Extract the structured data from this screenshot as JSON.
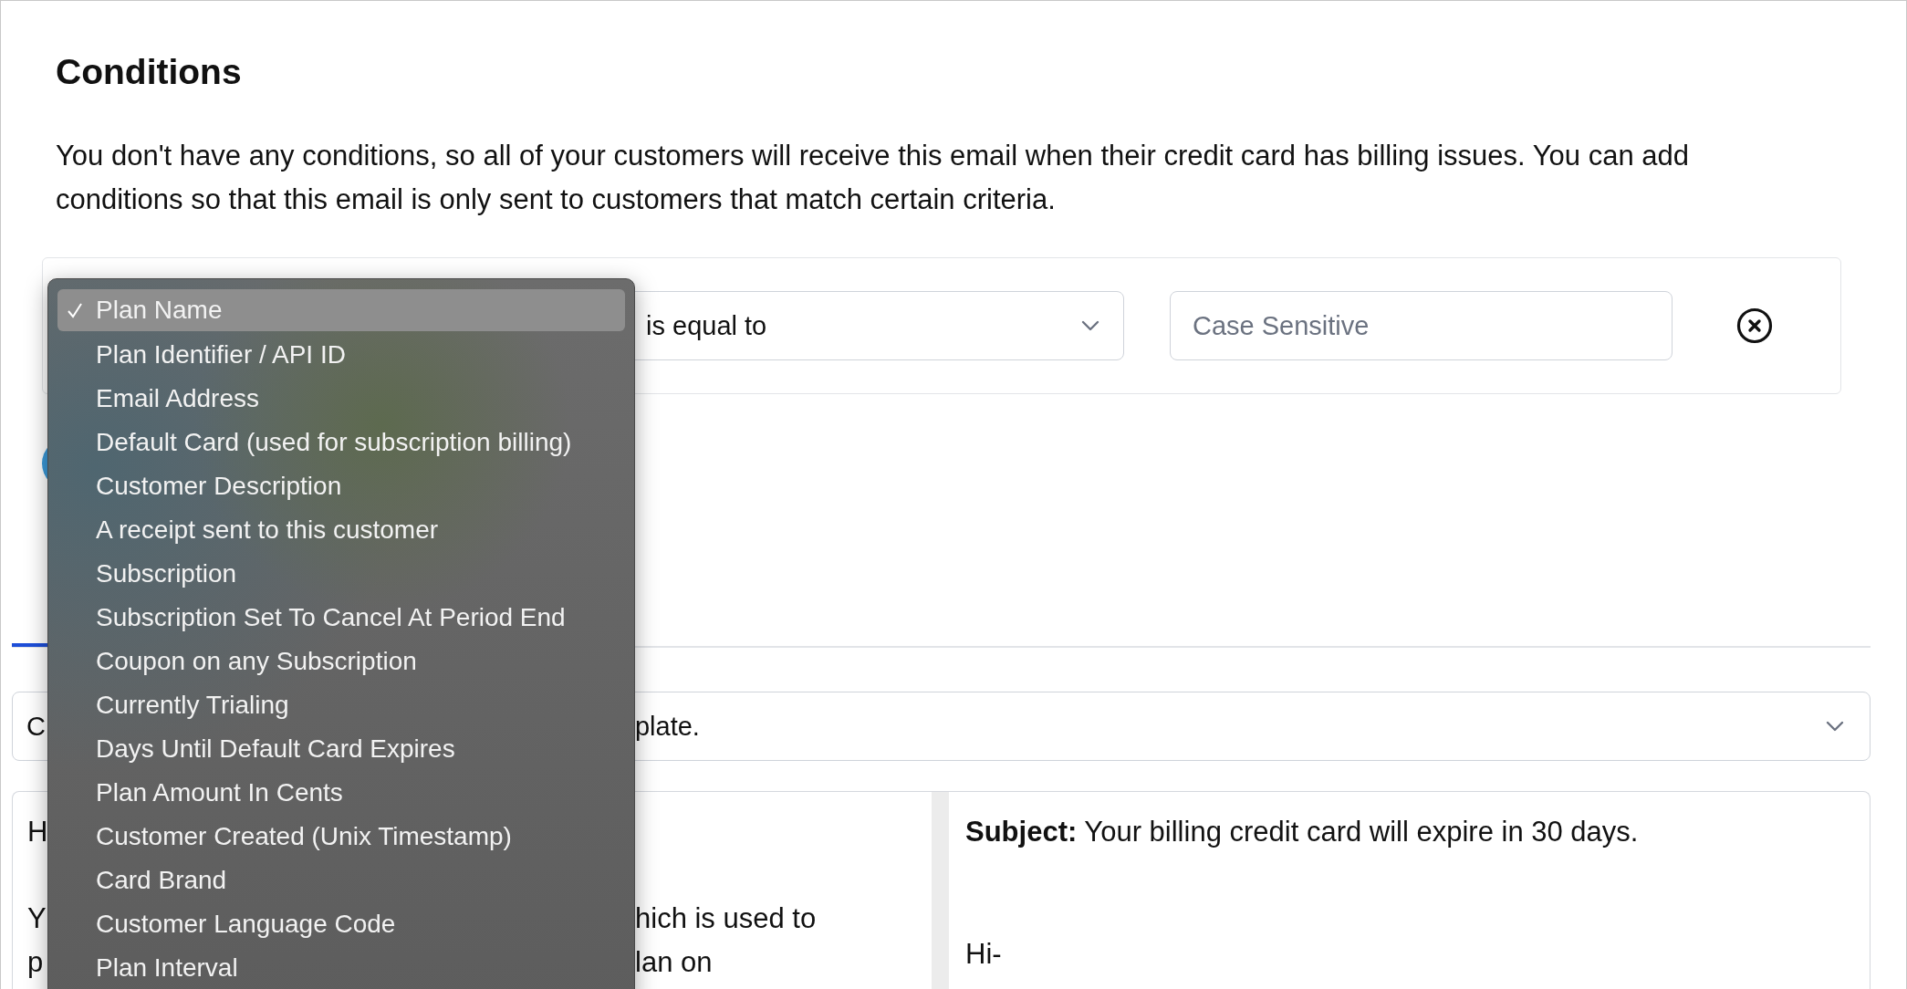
{
  "heading": "Conditions",
  "description": "You don't have any conditions, so all of your customers will receive this email when their credit card has billing issues. You can add conditions so that this email is only sent to customers that match certain criteria.",
  "condition": {
    "operator": "is equal to",
    "placeholder": "Case Sensitive"
  },
  "field_menu": {
    "items": [
      {
        "label": "Plan Name",
        "selected": true
      },
      {
        "label": "Plan Identifier / API ID",
        "selected": false
      },
      {
        "label": "Email Address",
        "selected": false
      },
      {
        "label": "Default Card (used for subscription billing)",
        "selected": false
      },
      {
        "label": "Customer Description",
        "selected": false
      },
      {
        "label": "A receipt sent to this customer",
        "selected": false
      },
      {
        "label": "Subscription",
        "selected": false
      },
      {
        "label": "Subscription Set To Cancel At Period End",
        "selected": false
      },
      {
        "label": "Coupon on any Subscription",
        "selected": false
      },
      {
        "label": "Currently Trialing",
        "selected": false
      },
      {
        "label": "Days Until Default Card Expires",
        "selected": false
      },
      {
        "label": "Plan Amount In Cents",
        "selected": false
      },
      {
        "label": "Customer Created (Unix Timestamp)",
        "selected": false
      },
      {
        "label": "Card Brand",
        "selected": false
      },
      {
        "label": "Customer Language Code",
        "selected": false
      },
      {
        "label": "Plan Interval",
        "selected": false
      }
    ]
  },
  "template_select": {
    "visible_start": "C",
    "visible_end": "plate."
  },
  "preview": {
    "left_lines": [
      {
        "start": "H"
      },
      {
        "start": "Y",
        "end": "hich is used to"
      },
      {
        "start": "p",
        "end": "lan on"
      }
    ],
    "subject": "**Subject:** Your billing credit card will expire in 30 days.",
    "greeting": "Hi-"
  }
}
